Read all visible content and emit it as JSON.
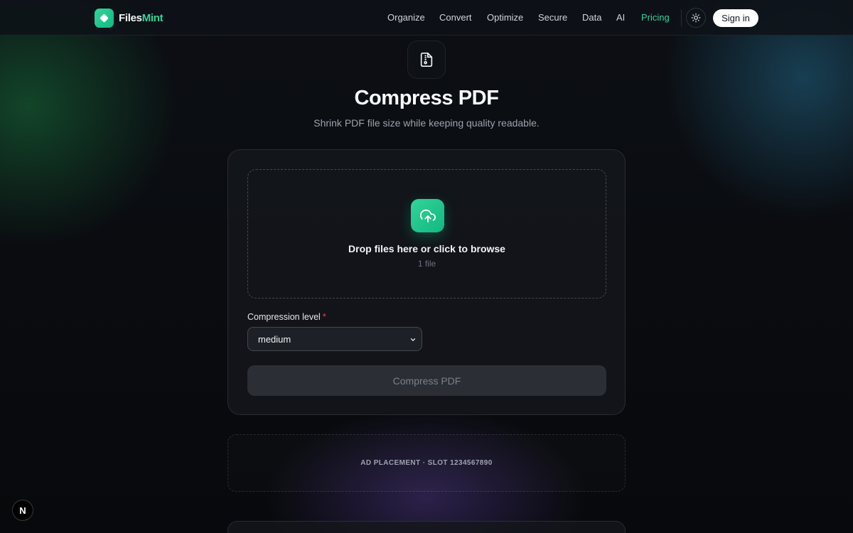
{
  "brand": {
    "name_part1": "Files",
    "name_part2": "Mint",
    "accent": "#34d399"
  },
  "nav": {
    "items": [
      {
        "label": "Organize"
      },
      {
        "label": "Convert"
      },
      {
        "label": "Optimize"
      },
      {
        "label": "Secure"
      },
      {
        "label": "Data"
      },
      {
        "label": "AI"
      },
      {
        "label": "Pricing",
        "active": true
      }
    ],
    "theme_toggle_icon": "sun-icon",
    "signin_label": "Sign in"
  },
  "hero": {
    "icon": "file-zip-icon",
    "title": "Compress PDF",
    "subtitle": "Shrink PDF file size while keeping quality readable."
  },
  "upload": {
    "icon": "cloud-upload-icon",
    "title": "Drop files here or click to browse",
    "count": "1 file"
  },
  "form": {
    "compression_label": "Compression level",
    "required_mark": "*",
    "compression_value": "medium",
    "submit_label": "Compress PDF"
  },
  "ad": {
    "label": "AD PLACEMENT · SLOT 1234567890"
  },
  "dev_indicator": {
    "letter": "N"
  }
}
